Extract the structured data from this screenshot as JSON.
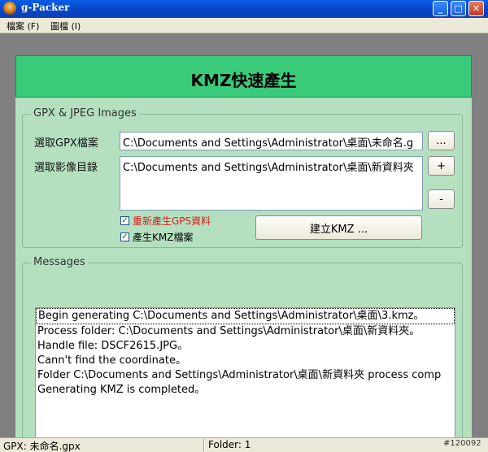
{
  "window": {
    "title": "g-Packer",
    "icon": "app-icon",
    "controls": {
      "minimize": "_",
      "maximize": "□",
      "close": "✕"
    }
  },
  "menu": {
    "items": [
      "檔案 (F)",
      "圖檔 (I)"
    ]
  },
  "header": {
    "title": "KMZ快速產生"
  },
  "gpx_group": {
    "legend": "GPX & JPEG Images",
    "gpx_label": "選取GPX檔案",
    "gpx_value": "C:\\Documents and Settings\\Administrator\\桌面\\未命名.g",
    "browse_label": "...",
    "image_dir_label": "選取影像目錄",
    "image_dir_value": "C:\\Documents and Settings\\Administrator\\桌面\\新資料夾",
    "add_label": "+",
    "remove_label": "-",
    "check_regen_gps": {
      "label": "重新產生GPS資料",
      "checked": true,
      "color": "#d81b1b"
    },
    "check_make_kmz": {
      "label": "產生KMZ檔案",
      "checked": true
    },
    "build_button": "建立KMZ ..."
  },
  "messages_group": {
    "legend": "Messages",
    "lines": [
      "Begin generating C:\\Documents and Settings\\Administrator\\桌面\\3.kmz。",
      "Process folder: C:\\Documents and Settings\\Administrator\\桌面\\新資料夾。",
      "Handle file: DSCF2615.JPG。",
      "Cann't find the coordinate。",
      "Folder C:\\Documents and Settings\\Administrator\\桌面\\新資料夾 process comp",
      "Generating KMZ is completed。"
    ]
  },
  "status": {
    "gpx": "GPX: 未命名.gpx",
    "folder": "Folder: 1",
    "extra": "#120092"
  },
  "colors": {
    "header_bg": "#3acb7a",
    "panel_bg": "#b4e0bf"
  }
}
